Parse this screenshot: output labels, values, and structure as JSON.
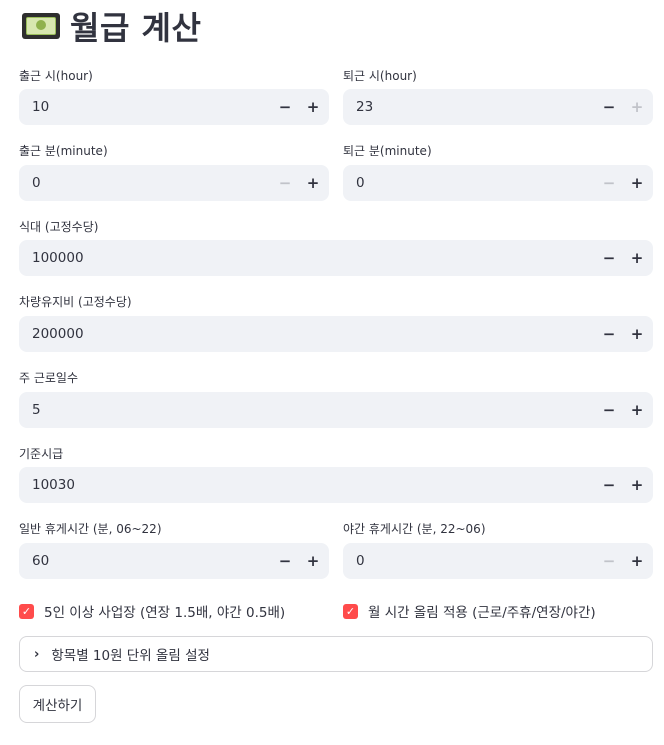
{
  "header": {
    "title": "월급 계산",
    "icon": "money-bill-emoji"
  },
  "fields": {
    "start_hour": {
      "label": "출근 시(hour)",
      "value": "10",
      "minus_enabled": true,
      "plus_enabled": true
    },
    "end_hour": {
      "label": "퇴근 시(hour)",
      "value": "23",
      "minus_enabled": true,
      "plus_enabled": false
    },
    "start_minute": {
      "label": "출근 분(minute)",
      "value": "0",
      "minus_enabled": false,
      "plus_enabled": true
    },
    "end_minute": {
      "label": "퇴근 분(minute)",
      "value": "0",
      "minus_enabled": false,
      "plus_enabled": true
    },
    "meal": {
      "label": "식대 (고정수당)",
      "value": "100000",
      "minus_enabled": true,
      "plus_enabled": true
    },
    "car": {
      "label": "차량유지비 (고정수당)",
      "value": "200000",
      "minus_enabled": true,
      "plus_enabled": true
    },
    "workdays": {
      "label": "주 근로일수",
      "value": "5",
      "minus_enabled": true,
      "plus_enabled": true
    },
    "base_wage": {
      "label": "기준시급",
      "value": "10030",
      "minus_enabled": true,
      "plus_enabled": true
    },
    "normal_break": {
      "label": "일반 휴게시간 (분, 06~22)",
      "value": "60",
      "minus_enabled": true,
      "plus_enabled": true
    },
    "night_break": {
      "label": "야간 휴게시간 (분, 22~06)",
      "value": "0",
      "minus_enabled": false,
      "plus_enabled": true
    }
  },
  "stepper": {
    "minus": "−",
    "plus": "+"
  },
  "checkboxes": {
    "five_plus": {
      "label": "5인 이상 사업장 (연장 1.5배, 야간 0.5배)",
      "checked": true
    },
    "round_up": {
      "label": "월 시간 올림 적용 (근로/주휴/연장/야간)",
      "checked": true
    }
  },
  "expander": {
    "label": "항목별 10원 단위 올림 설정",
    "chevron": "›"
  },
  "calc_button": {
    "label": "계산하기"
  },
  "colors": {
    "accent": "#ff4b4b",
    "input_bg": "#f0f2f6",
    "text": "#31333f"
  }
}
